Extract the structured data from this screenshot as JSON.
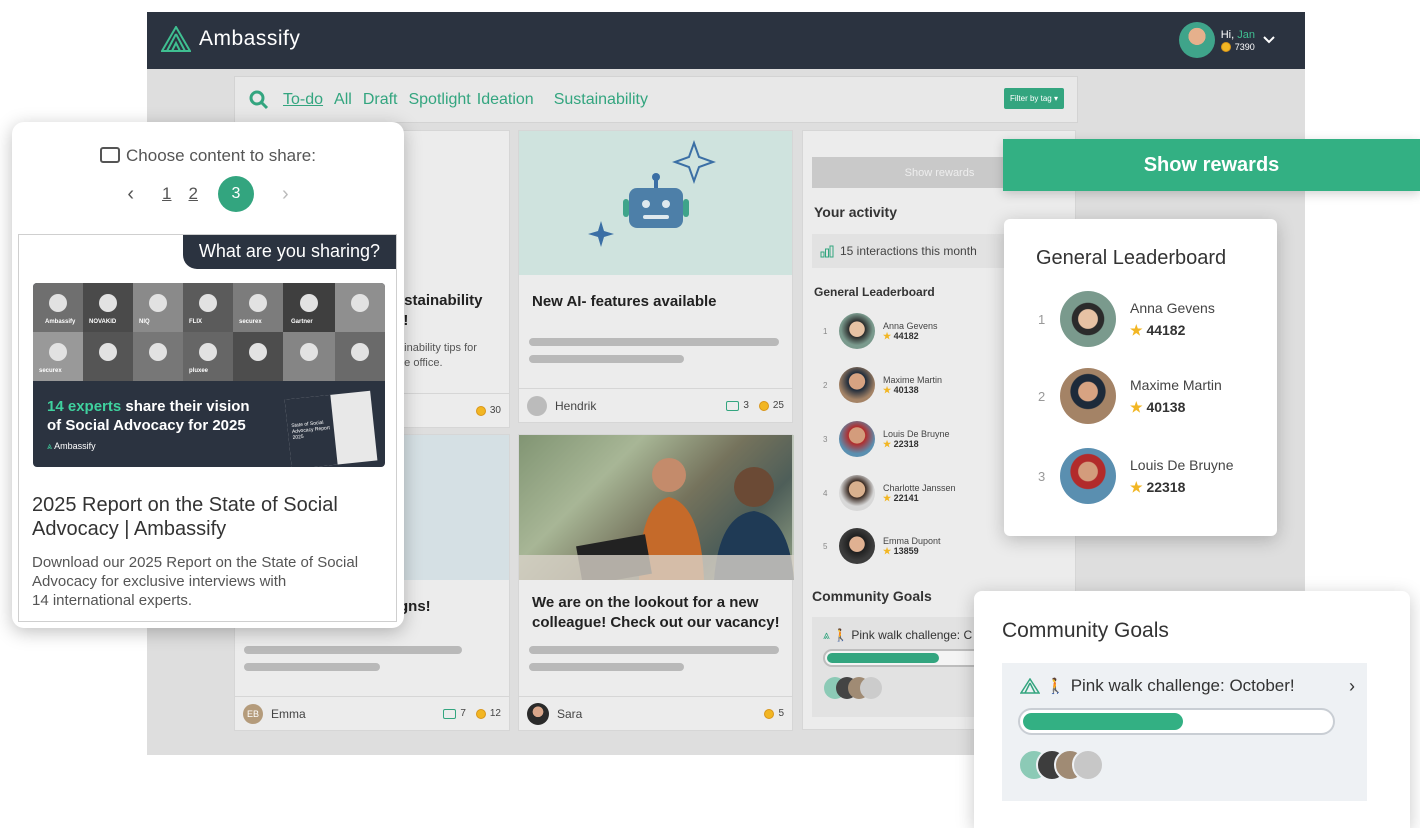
{
  "app": {
    "brand": "Ambassify",
    "greeting_prefix": "Hi,",
    "user_name": "Jan",
    "user_points": "7390"
  },
  "tabs": [
    "To-do",
    "All",
    "Draft",
    "Spotlight",
    "Ideation",
    "Sustainability"
  ],
  "filter_button": "Filter by tag",
  "cards": {
    "sustainability": {
      "title_partial_1": "ustainability",
      "title_partial_2": "k!",
      "desc_partial_1": "tainability tips for",
      "desc_partial_2": "the office.",
      "coins": "30"
    },
    "ai": {
      "title": "New AI- features available",
      "author": "Hendrik",
      "comments": "3",
      "coins": "25"
    },
    "campaigns": {
      "title_partial": "gns!",
      "author_initials": "EB",
      "author": "Emma",
      "comments": "7",
      "coins": "12"
    },
    "vacancy": {
      "title": "We are on the lookout for a new colleague! Check out our vacancy!",
      "author": "Sara",
      "coins": "5"
    }
  },
  "sidebar": {
    "show_rewards": "Show rewards",
    "your_activity": "Your activity",
    "interactions": "15 interactions this month",
    "leaderboard_title": "General Leaderboard",
    "leaderboard": [
      {
        "rank": "1",
        "name": "Anna Gevens",
        "points": "44182"
      },
      {
        "rank": "2",
        "name": "Maxime Martin",
        "points": "40138"
      },
      {
        "rank": "3",
        "name": "Louis De Bruyne",
        "points": "22318"
      },
      {
        "rank": "4",
        "name": "Charlotte Janssen",
        "points": "22141"
      },
      {
        "rank": "5",
        "name": "Emma Dupont",
        "points": "13859"
      }
    ],
    "community_goals": "Community Goals",
    "goal": "Pink walk challenge: C"
  },
  "share_panel": {
    "heading": "Choose content to share:",
    "pages": [
      "1",
      "2"
    ],
    "current_page": "3",
    "sharing_label": "What are you sharing?",
    "banner_highlight": "14 experts",
    "banner_text_1": " share their vision",
    "banner_text_2": "of Social Advocacy for 2025",
    "banner_brand": "Ambassify",
    "banner_logos": [
      "Ambassify",
      "NOVAKID",
      "NIQ",
      "FLIX",
      "securex",
      "Gartner",
      "securex",
      "pluxee"
    ],
    "report_cover": "State of Social Advocacy Report 2025",
    "title": "2025 Report on the State of Social Advocacy | Ambassify",
    "description_1": "Download our 2025 Report on the State of Social Advocacy for exclusive interviews with",
    "description_2": "14 international experts."
  },
  "rewards_bar": "Show rewards",
  "leaderboard_panel": {
    "title": "General Leaderboard",
    "rows": [
      {
        "rank": "1",
        "name": "Anna Gevens",
        "points": "44182"
      },
      {
        "rank": "2",
        "name": "Maxime Martin",
        "points": "40138"
      },
      {
        "rank": "3",
        "name": "Louis De Bruyne",
        "points": "22318"
      }
    ]
  },
  "goals_panel": {
    "title": "Community Goals",
    "goal_name": "Pink walk challenge: October!",
    "progress": 0.52
  },
  "colors": {
    "accent": "#33b083",
    "dark": "#2b3340",
    "coin": "#f2b623"
  }
}
